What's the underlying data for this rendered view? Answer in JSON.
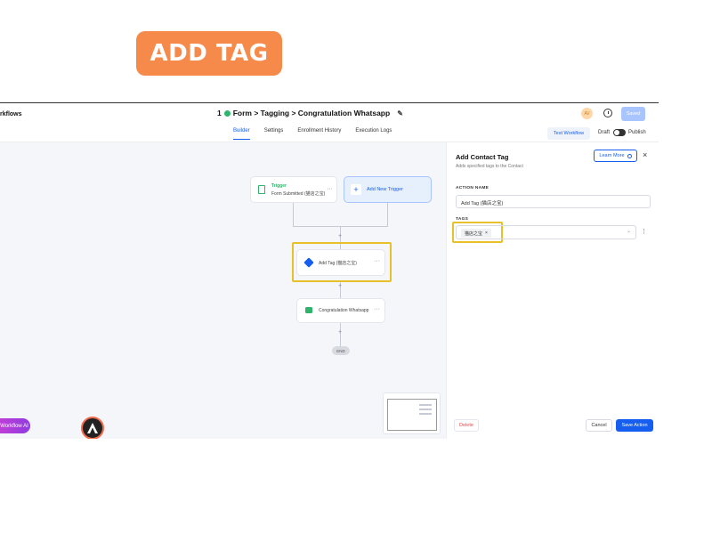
{
  "badge": {
    "label": "ADD TAG"
  },
  "header": {
    "brand": "rkflows",
    "title_prefix": "1",
    "title": "Form > Tagging > Congratulation Whatsapp",
    "avatar_initials": "AV",
    "saved_label": "Saved",
    "tabs": [
      "Builder",
      "Settings",
      "Enrollment History",
      "Execution Logs"
    ],
    "active_tab": "Builder",
    "test_workflow_label": "Test Workflow",
    "draft_label": "Draft",
    "publish_label": "Publish"
  },
  "canvas": {
    "trigger_node": {
      "type_label": "Trigger",
      "name": "Form Submitted (猫店之宝)"
    },
    "add_trigger_label": "Add New Trigger",
    "tag_node": {
      "name": "Add Tag (猫店之宝)"
    },
    "whatsapp_node": {
      "name": "Congratulation Whatsapp"
    },
    "end_label": "END",
    "workflow_ai_label": "Workflow AI"
  },
  "panel": {
    "title": "Add Contact Tag",
    "subtitle": "Adds specified tags to the Contact",
    "learn_more_label": "Learn More",
    "action_name_label": "ACTION NAME",
    "action_name_value": "Add Tag (猫店之宝)",
    "tags_label": "TAGS",
    "tags": [
      "猫店之宝"
    ],
    "delete_label": "Delete",
    "cancel_label": "Cancel",
    "save_label": "Save Action"
  },
  "colors": {
    "badge_orange": "#f58a4b",
    "primary_blue": "#155eef",
    "highlight_yellow": "#e8c02a",
    "trigger_green": "#2fb56b",
    "delete_red": "#e5484d"
  }
}
